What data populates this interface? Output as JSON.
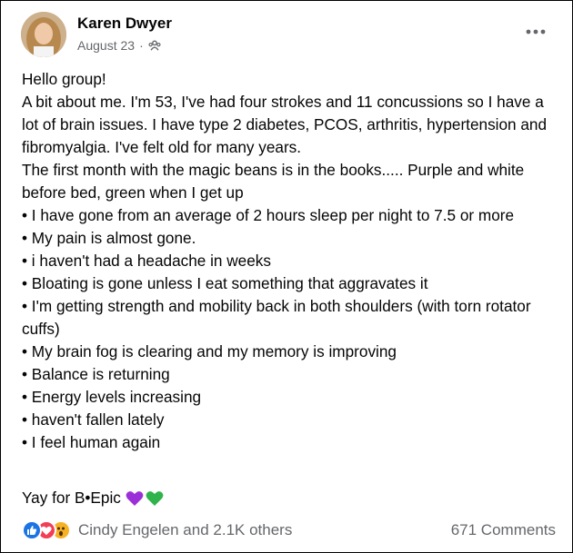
{
  "post": {
    "author": "Karen Dwyer",
    "date": "August 23",
    "separator": "·",
    "privacy_icon": "group-icon",
    "more_icon": "more-options-icon",
    "lines": [
      "Hello group!",
      "A bit about me. I'm 53, I've had four strokes and 11 concussions so I have a lot of brain issues. I have type 2 diabetes, PCOS, arthritis, hypertension and fibromyalgia. I've felt old for many years.",
      "The first month with the magic beans is in the books..... Purple and white before bed, green when I get up",
      "• I have gone from an average of 2 hours sleep per night to 7.5 or more",
      "• My pain is almost gone.",
      "• i haven't had a headache in weeks",
      "• Bloating is gone unless I eat something that aggravates it",
      "• I'm getting strength and mobility back in both shoulders (with torn rotator cuffs)",
      "• My brain fog is clearing and my memory is improving",
      "• Balance is returning",
      "• Energy levels increasing",
      "• haven't fallen lately",
      "• I feel human again"
    ],
    "closing": "Yay for B•Epic",
    "closing_emojis": [
      "purple-heart-icon",
      "green-heart-icon"
    ]
  },
  "footer": {
    "reactions": [
      "like-icon",
      "love-icon",
      "wow-icon"
    ],
    "reaction_text": "Cindy Engelen and 2.1K others",
    "comments": "671 Comments"
  },
  "colors": {
    "text": "#050505",
    "secondary": "#65676b",
    "like": "#1b74e4",
    "love": "#f33e58",
    "wow": "#f7b125",
    "purple_heart": "#9b30d9",
    "green_heart": "#2fb34a"
  }
}
